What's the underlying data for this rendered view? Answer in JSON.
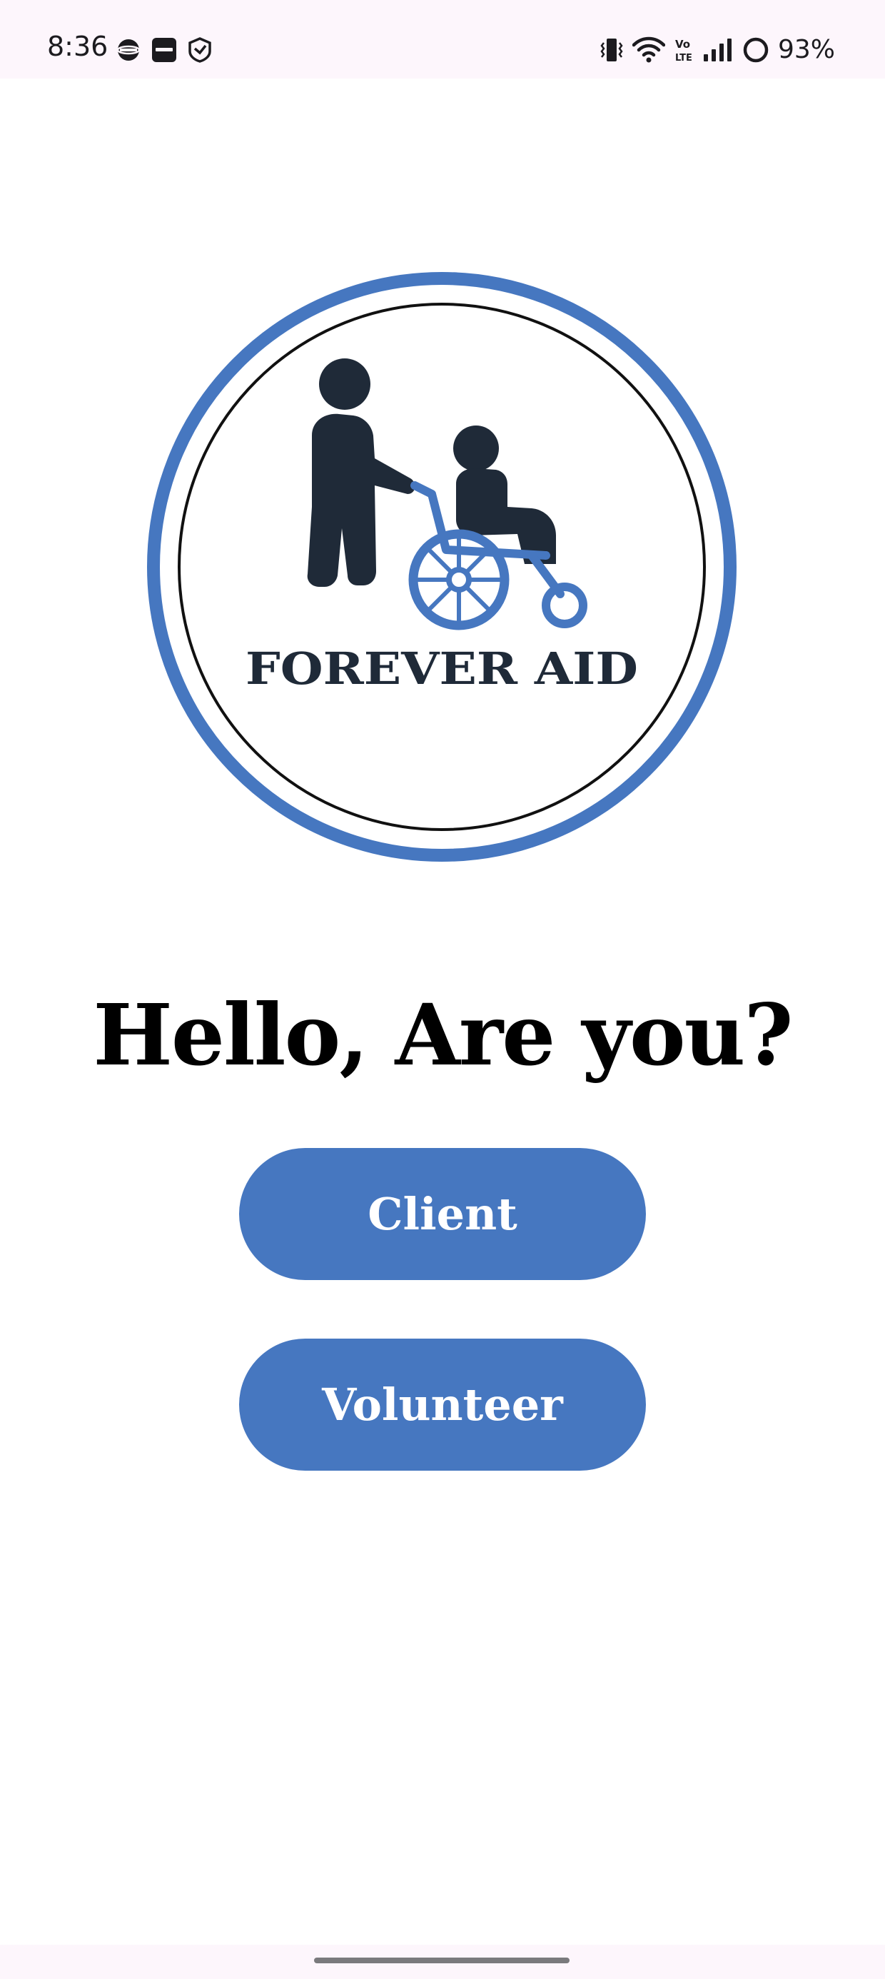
{
  "status_bar": {
    "time": "8:36",
    "left_icons": [
      "vpn-globe-icon",
      "app-badge-icon",
      "shield-icon"
    ],
    "right_icons": [
      "vibrate-icon",
      "wifi-icon",
      "volte-icon",
      "signal-icon",
      "battery-ring-icon"
    ],
    "battery": "93%"
  },
  "logo": {
    "text": "FOREVER AID",
    "icon": "caregiver-wheelchair-icon"
  },
  "main": {
    "greeting": "Hello, Are you?",
    "buttons": {
      "client": "Client",
      "volunteer": "Volunteer"
    }
  },
  "colors": {
    "accent": "#4677c0",
    "logo_dark": "#1f2a38",
    "text": "#000000",
    "status_bg": "#fdf6fc"
  }
}
